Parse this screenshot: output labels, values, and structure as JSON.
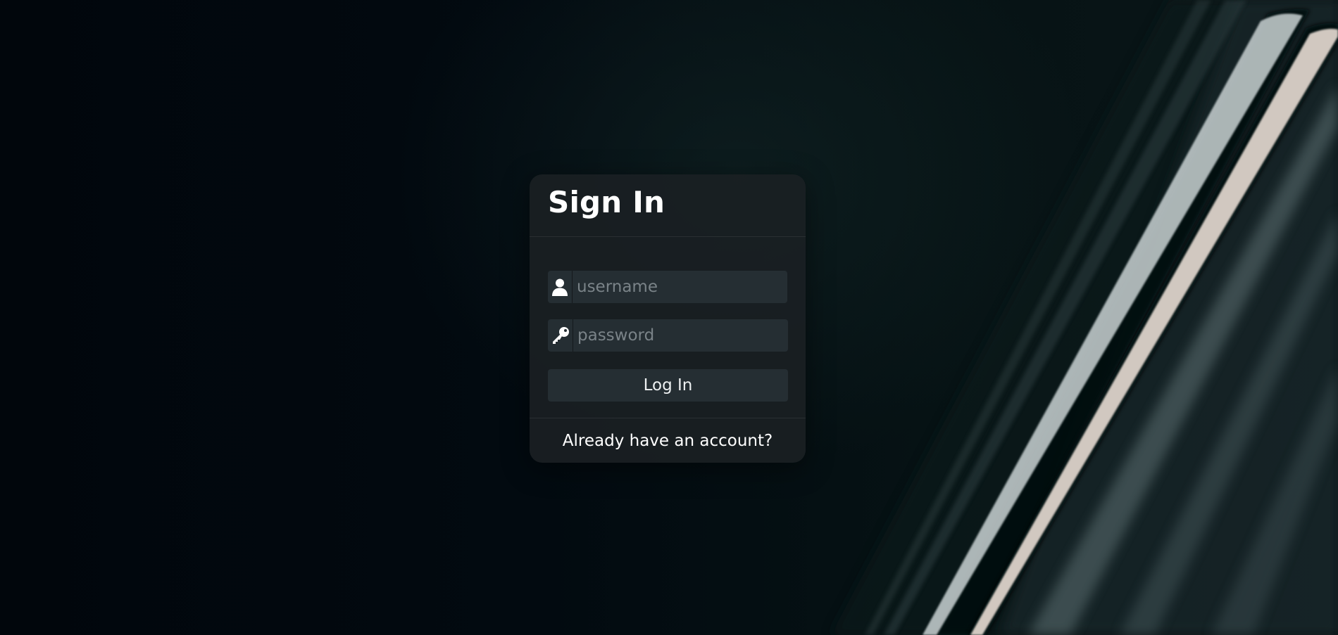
{
  "page": {
    "background_colors": [
      "#01060c",
      "#0a1618"
    ],
    "stripe_colors": [
      "#c9d2d3",
      "#e8ddd4",
      "#5d6f72"
    ]
  },
  "signin": {
    "title": "Sign In",
    "username": {
      "icon": "user-icon",
      "placeholder": "username",
      "value": ""
    },
    "password": {
      "icon": "key-icon",
      "placeholder": "password",
      "value": ""
    },
    "login_button_label": "Log In",
    "footer_link": "Already have an account?"
  },
  "colors": {
    "card_bg": "#1a2023",
    "field_bg": "#252e33",
    "text": "#ffffff",
    "placeholder": "#7a8388"
  }
}
